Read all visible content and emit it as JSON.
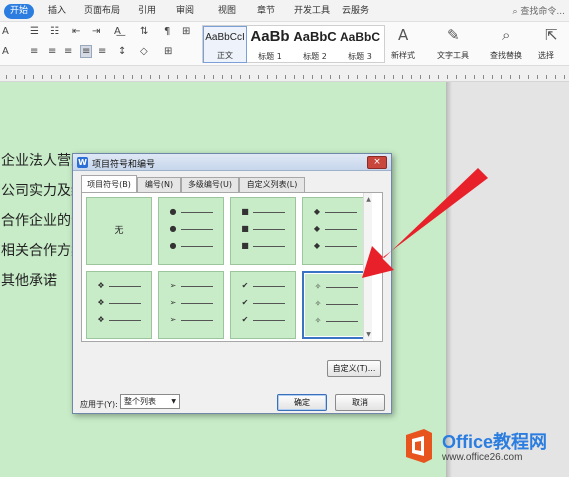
{
  "ribbon": {
    "tabs": [
      "开始",
      "插入",
      "页面布局",
      "引用",
      "审阅",
      "视图",
      "章节",
      "开发工具",
      "云服务"
    ],
    "active_tab": "开始",
    "search_placeholder": "查找命令...",
    "styles": [
      {
        "sample": "AaBbCcI",
        "name": "正文"
      },
      {
        "sample": "AaBb",
        "name": "标题 1"
      },
      {
        "sample": "AaBbC",
        "name": "标题 2"
      },
      {
        "sample": "AaBbC",
        "name": "标题 3"
      }
    ],
    "new_style_label": "新样式",
    "text_tools_label": "文字工具",
    "find_replace_label": "查找替换",
    "select_label": "选择"
  },
  "document": {
    "lines": [
      "企业法人营业",
      "公司实力及经",
      "合作企业的合",
      "相关合作方案",
      "其他承诺"
    ]
  },
  "dialog": {
    "title": "项目符号和编号",
    "close_symbol": "×",
    "tabs": [
      "项目符号(B)",
      "编号(N)",
      "多级编号(U)",
      "自定义列表(L)"
    ],
    "active_tab": "项目符号(B)",
    "none_label": "无",
    "bullet_options": [
      {
        "id": "none",
        "symbol": ""
      },
      {
        "id": "filled-circle",
        "symbol": "●"
      },
      {
        "id": "filled-square",
        "symbol": "■"
      },
      {
        "id": "filled-diamond",
        "symbol": "◆"
      },
      {
        "id": "four-diamond",
        "symbol": "❖"
      },
      {
        "id": "arrowhead",
        "symbol": "➢"
      },
      {
        "id": "checkmark",
        "symbol": "✔"
      },
      {
        "id": "star-diamond",
        "symbol": "✧"
      }
    ],
    "selected_option": "star-diamond",
    "customize_button": "自定义(T)...",
    "apply_to_label": "应用于(Y):",
    "apply_to_value": "整个列表",
    "ok_button": "确定",
    "cancel_button": "取消"
  },
  "watermark": {
    "title": "Office教程网",
    "url": "www.office26.com"
  },
  "colors": {
    "page_background": "#c8ecc8",
    "accent": "#2b7de0",
    "annotation_arrow": "#e8202a"
  }
}
